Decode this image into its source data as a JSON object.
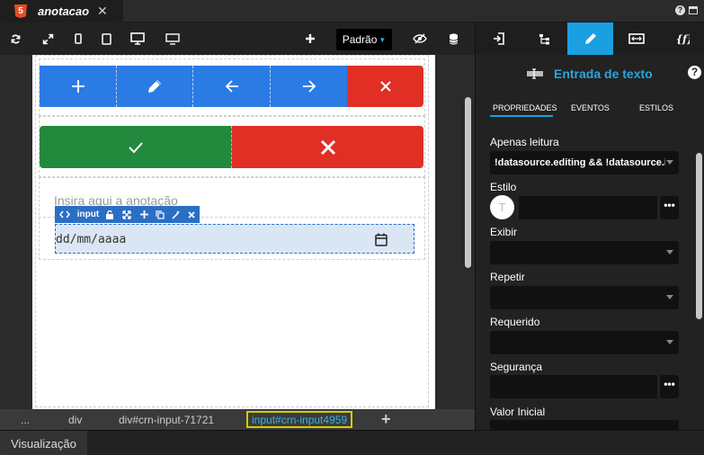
{
  "tab": {
    "html5_label": "5",
    "label": "anotacao",
    "close": "✕"
  },
  "top_right": {
    "help": "?"
  },
  "toolbar": {
    "refresh_icon": "refresh-icon",
    "padrao_label": "Padrão"
  },
  "canvas": {
    "buttons_row1": [
      "plus-icon",
      "pencil-icon",
      "arrow-left-icon",
      "arrow-right-icon",
      "close-icon"
    ],
    "buttons_row2": [
      "check-icon",
      "close-icon"
    ],
    "placeholder": "Insira aqui a anotação",
    "selection_label": "input",
    "date_placeholder": "dd/mm/aaaa"
  },
  "breadcrumb": {
    "items": [
      "...",
      "div",
      "div#crn-input-71721"
    ],
    "active": "input#crn-input4959",
    "add": "+"
  },
  "bottom": {
    "visualizacao": "Visualização"
  },
  "panel": {
    "title": "Entrada de texto",
    "help": "?",
    "subtabs": [
      "PROPRIEDADES",
      "EVENTOS",
      "ESTILOS"
    ],
    "fields": {
      "apenas_leitura_label": "Apenas leitura",
      "apenas_leitura_value": "!datasource.editing && !datasource.in",
      "estilo_label": "Estilo",
      "estilo_avatar": "T",
      "exibir_label": "Exibir",
      "repetir_label": "Repetir",
      "requerido_label": "Requerido",
      "seguranca_label": "Segurança",
      "valor_inicial_label": "Valor Inicial",
      "dots": "•••"
    }
  },
  "colors": {
    "accent": "#1a9fe0",
    "blue": "#2b7be4",
    "red": "#e12f26",
    "green": "#22893d"
  }
}
